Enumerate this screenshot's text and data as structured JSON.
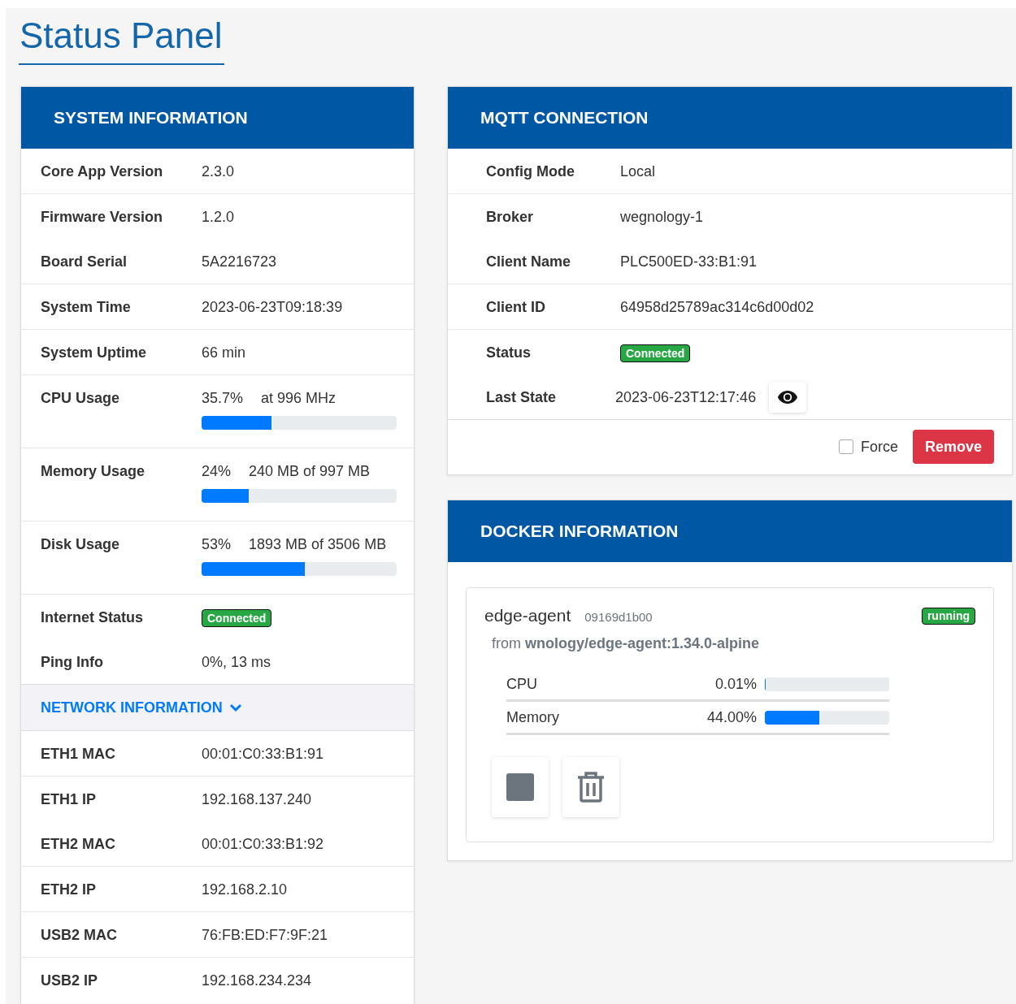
{
  "title": "Status Panel",
  "system_information": {
    "title": "SYSTEM INFORMATION",
    "row_groups": [
      [
        {
          "kind": "text",
          "label": "Core App Version",
          "value": "2.3.0"
        }
      ],
      [
        {
          "kind": "text",
          "label": "Firmware Version",
          "value": "1.2.0"
        },
        {
          "kind": "text",
          "label": "Board Serial",
          "value": "5A2216723"
        }
      ],
      [
        {
          "kind": "text",
          "label": "System Time",
          "value": "2023-06-23T09:18:39"
        }
      ],
      [
        {
          "kind": "text",
          "label": "System Uptime",
          "value": "66 min"
        }
      ],
      [
        {
          "kind": "meter",
          "label": "CPU Usage",
          "reading": "35.7%",
          "detail": "at 996 MHz",
          "level": 0.357
        }
      ],
      [
        {
          "kind": "meter",
          "label": "Memory Usage",
          "reading": "24%",
          "detail": "240 MB of 997 MB",
          "level": 0.24
        }
      ],
      [
        {
          "kind": "meter",
          "label": "Disk Usage",
          "reading": "53%",
          "detail": "1893 MB of 3506 MB",
          "level": 0.53
        }
      ],
      [
        {
          "kind": "badge",
          "label": "Internet Status",
          "value": "Connected"
        },
        {
          "kind": "text",
          "label": "Ping Info",
          "value": "0%, 13 ms"
        }
      ]
    ],
    "network": {
      "title": "NETWORK INFORMATION",
      "expanded": true,
      "row_groups": [
        [
          {
            "kind": "text",
            "label": "ETH1 MAC",
            "value": "00:01:C0:33:B1:91"
          }
        ],
        [
          {
            "kind": "text",
            "label": "ETH1 IP",
            "value": "192.168.137.240"
          },
          {
            "kind": "text",
            "label": "ETH2 MAC",
            "value": "00:01:C0:33:B1:92"
          }
        ],
        [
          {
            "kind": "text",
            "label": "ETH2 IP",
            "value": "192.168.2.10"
          }
        ],
        [
          {
            "kind": "text",
            "label": "USB2 MAC",
            "value": "76:FB:ED:F7:9F:21"
          }
        ],
        [
          {
            "kind": "text",
            "label": "USB2 IP",
            "value": "192.168.234.234"
          }
        ]
      ]
    }
  },
  "mqtt_connection": {
    "title": "MQTT CONNECTION",
    "row_groups": [
      [
        {
          "kind": "text",
          "label": "Config Mode",
          "value": "Local"
        }
      ],
      [
        {
          "kind": "text",
          "label": "Broker",
          "value": "wegnology-1"
        },
        {
          "kind": "text",
          "label": "Client Name",
          "value": "PLC500ED-33:B1:91"
        }
      ],
      [
        {
          "kind": "text",
          "label": "Client ID",
          "value": "64958d25789ac314c6d00d02"
        }
      ],
      [
        {
          "kind": "badge",
          "label": "Status",
          "value": "Connected"
        },
        {
          "kind": "viewable",
          "label": "Last State",
          "value": "2023-06-23T12:17:46"
        }
      ]
    ],
    "force": {
      "label": "Force",
      "checked": false
    },
    "remove_button": "Remove"
  },
  "docker_information": {
    "title": "DOCKER INFORMATION",
    "containers": [
      {
        "name": "edge-agent",
        "id": "09169d1b00",
        "status": "running",
        "image": "from **wnology/edge-agent:1.34.0-alpine**",
        "metrics": [
          {
            "label": "CPU",
            "reading": "0.01%",
            "level": 0.0001
          },
          {
            "label": "Memory",
            "reading": "44.00%",
            "level": 0.44
          }
        ]
      }
    ]
  }
}
